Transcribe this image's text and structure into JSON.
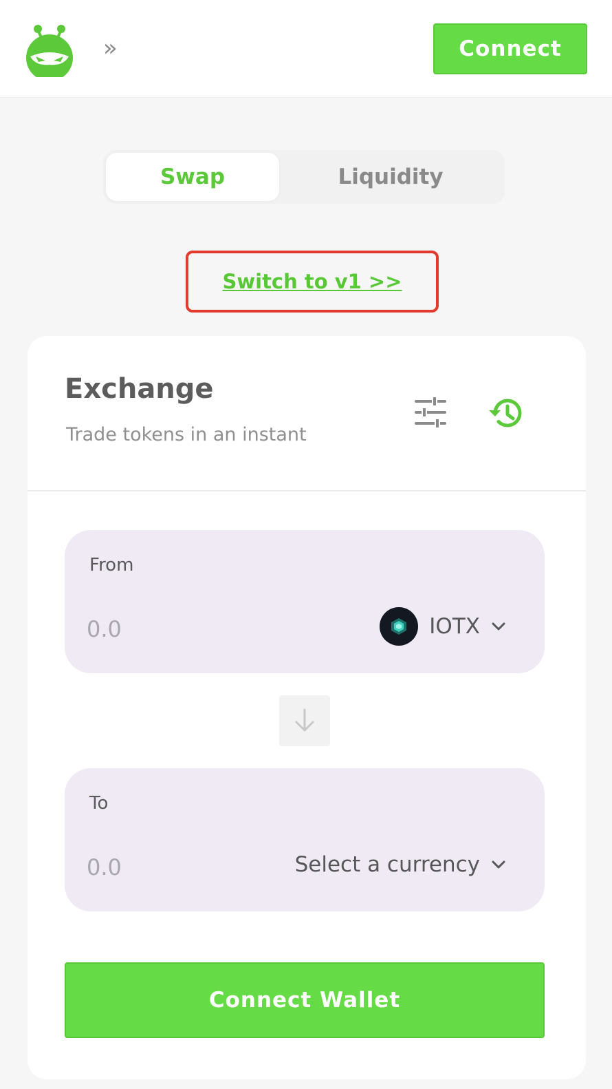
{
  "header": {
    "logo_icon": "robot-mascot-icon",
    "menu_icon": "double-chevron-right-icon",
    "menu_glyph": "»",
    "connect_label": "Connect"
  },
  "tabs": [
    {
      "label": "Swap",
      "active": true
    },
    {
      "label": "Liquidity",
      "active": false
    }
  ],
  "switch_link": "Switch to v1 >>",
  "exchange": {
    "title": "Exchange",
    "subtitle": "Trade tokens in an instant",
    "settings_icon": "sliders-icon",
    "history_icon": "history-clock-icon"
  },
  "from": {
    "label": "From",
    "amount_placeholder": "0.0",
    "token": "IOTX",
    "token_icon": "iotx-token-icon"
  },
  "swap_arrow_icon": "arrow-down-icon",
  "to": {
    "label": "To",
    "amount_placeholder": "0.0",
    "token": "Select a currency"
  },
  "connect_wallet_label": "Connect Wallet",
  "colors": {
    "brand_green": "#65db45",
    "link_green": "#58c837",
    "highlight_red": "#e23a2e",
    "panel_bg": "#efeaf4"
  }
}
